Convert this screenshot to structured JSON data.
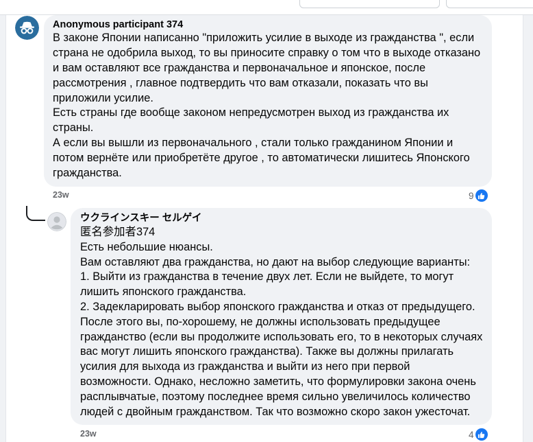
{
  "comment": {
    "author": "Anonymous participant 374",
    "lines": [
      "В законе Японии написанно \"приложить усилие в выходе из гражданства \", если",
      "страна не одобрила выход, то вы приносите справку о том что в выходе отказано",
      "и вам оставляют все гражданства и первоначальное и японское, после",
      "рассмотрения , главное подтвердить что вам отказали, показать что вы",
      "приложили усилие.",
      "Есть страны где вообще законом непредусмотрен выход из гражданства их",
      "страны.",
      "А если вы вышли из первоначального , стали только гражданином Японии и",
      "потом вернёте или приобретёте другое , то автоматически лишитесь Японского",
      "гражданства."
    ],
    "time": "23w",
    "like_count": "9"
  },
  "reply": {
    "author": "ウクラインスキー セルゲイ",
    "lines": [
      "匿名参加者374",
      "Есть небольшие нюансы.",
      "Вам оставляют два гражданства, но дают на выбор следующие варианты:",
      "1. Выйти из гражданства в течение двух лет. Если не выйдете, то могут",
      "лишить японского гражданства.",
      "2. Задекларировать выбор японского гражданства и отказ от предыдущего.",
      "После этого вы, по-хорошему, не должны использовать предыдущее",
      "гражданство (если вы продолжите использовать его, то в некоторых случаях",
      "вас могут лишить японского гражданства). Также вы должны прилагать",
      "усилия для выхода из гражданства и выйти из него при первой",
      "возможности. Однако, несложно заметить, что формулировки закона очень",
      "расплывчатые, поэтому последнее время сильно увеличилось количество",
      "людей с двойным гражданством. Так что возможно скоро закон ужесточат."
    ],
    "time": "23w",
    "like_count": "4"
  },
  "icons": {
    "comment_avatar": "anonymous-incognito-icon",
    "reply_avatar": "default-user-avatar-icon",
    "like": "thumbs-up-icon"
  },
  "colors": {
    "accent": "#1877f2",
    "anon_avatar": "#2a6d9e",
    "bubble": "#f0f2f5",
    "meta_text": "#65676b"
  }
}
